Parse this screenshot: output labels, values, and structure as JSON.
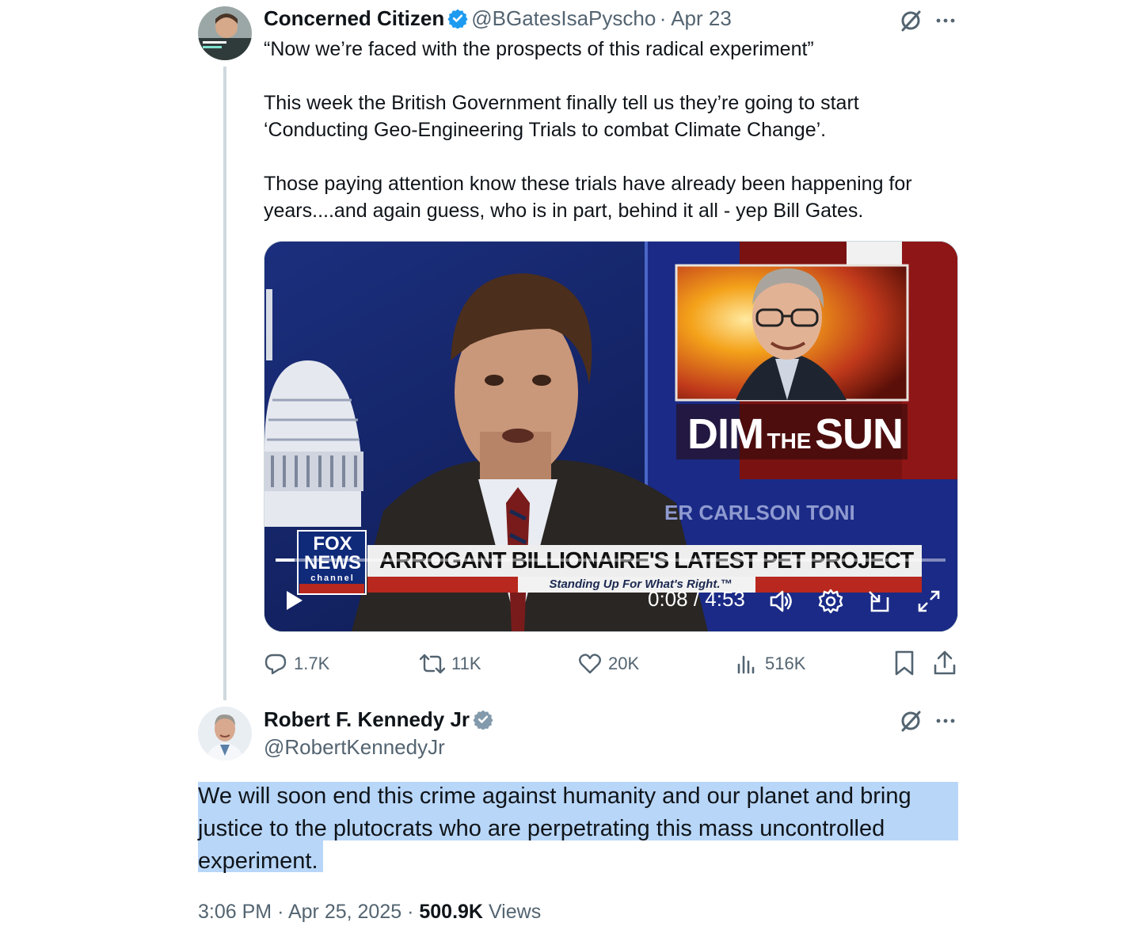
{
  "original_tweet": {
    "author_name": "Concerned Citizen",
    "handle": "@BGatesIsaPyscho",
    "date": "· Apr 23",
    "paragraphs": [
      "“Now we’re faced with the prospects of this radical experiment”",
      "This week the British Government finally tell us they’re going to start ‘Conducting Geo-Engineering Trials to combat Climate Change’.",
      "Those paying attention know these trials have already been happening for years....and again guess, who is in part, behind it all - yep Bill Gates."
    ],
    "video": {
      "headline": "DIM",
      "headline_the": "THE",
      "headline_sun": "SUN",
      "chyron": "ARROGANT BILLIONAIRE'S LATEST PET PROJECT",
      "chyron_sub": "Standing Up For What's Right.™",
      "show_name": "ER CARLSON TONI",
      "network_top": "FOX",
      "network_mid": "NEWS",
      "network_bottom": "channel",
      "time": "0:08 / 4:53",
      "progress_fraction": 0.028
    },
    "metrics": {
      "replies": "1.7K",
      "reposts": "11K",
      "likes": "20K",
      "views": "516K"
    }
  },
  "reply_tweet": {
    "author_name": "Robert F. Kennedy Jr",
    "handle": "@RobertKennedyJr",
    "text": "We will soon end this crime against humanity and our planet and bring justice to the plutocrats who are perpetrating this mass uncontrolled experiment.",
    "time": "3:06 PM",
    "date": "Apr 25, 2025",
    "views_count": "500.9K",
    "views_label": "Views"
  },
  "icons": [
    "grok-icon",
    "more-icon",
    "reply-icon",
    "repost-icon",
    "like-icon",
    "views-icon",
    "bookmark-icon",
    "share-icon",
    "verified-badge-icon",
    "play-icon",
    "volume-icon",
    "settings-icon",
    "pip-icon",
    "fullscreen-icon"
  ],
  "colors": {
    "verified_blue": "#1d9bf0",
    "verified_gray": "#829aab",
    "highlight": "#b8d6f8",
    "secondary_text": "#536471"
  }
}
